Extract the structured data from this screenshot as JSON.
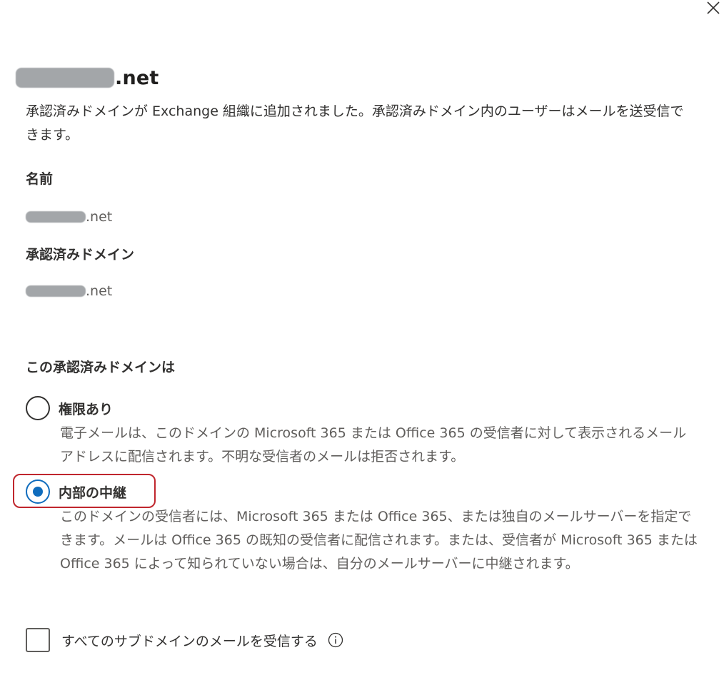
{
  "panel": {
    "close_icon": "close-icon",
    "title_suffix": ".net",
    "description": "承認済みドメインが Exchange 組織に追加されました。承認済みドメイン内のユーザーはメールを送受信できます。"
  },
  "name_field": {
    "label": "名前",
    "value_suffix": ".net"
  },
  "accepted_domain_field": {
    "label": "承認済みドメイン",
    "value_suffix": ".net"
  },
  "domain_type": {
    "heading": "この承認済みドメインは",
    "options": [
      {
        "label": "権限あり",
        "description": "電子メールは、このドメインの Microsoft 365 または Office 365 の受信者に対して表示されるメール アドレスに配信されます。不明な受信者のメールは拒否されます。",
        "selected": false
      },
      {
        "label": "内部の中継",
        "description": "このドメインの受信者には、Microsoft 365 または Office 365、または独自のメールサーバーを指定できます。メールは Office 365 の既知の受信者に配信されます。または、受信者が Microsoft 365 または Office 365 によって知られていない場合は、自分のメールサーバーに中継されます。",
        "selected": true
      }
    ],
    "highlight_color": "#c0262d"
  },
  "subdomains": {
    "label": "すべてのサブドメインのメールを受信する",
    "checked": false,
    "info_icon": "info-icon"
  },
  "colors": {
    "accent": "#0f6cbd",
    "text_primary": "#323130",
    "text_secondary": "#605e5c",
    "annotation": "#c0262d"
  }
}
